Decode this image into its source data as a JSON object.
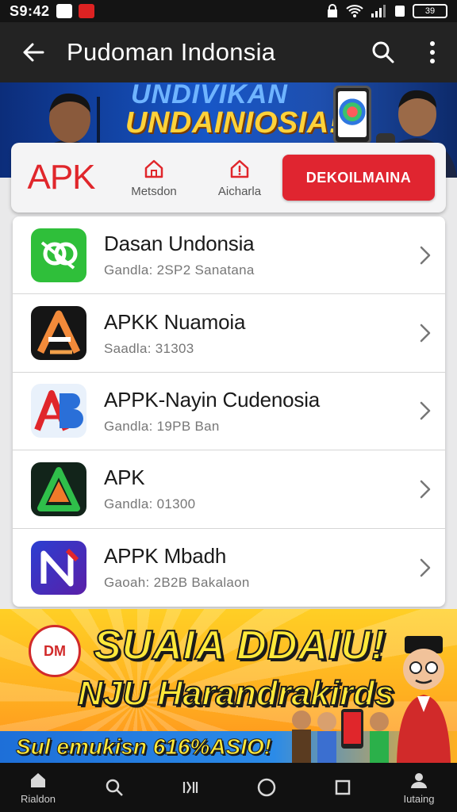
{
  "status_bar": {
    "time": "S9:42",
    "battery": "39"
  },
  "app_bar": {
    "title": "Pudoman Indonsia"
  },
  "top_banner": {
    "line1": "UNDIVIKAN",
    "line2": "UNDAINIOSIA!"
  },
  "tabs": {
    "logo": "APK",
    "items": [
      {
        "label": "Metsdon",
        "icon": "home-icon"
      },
      {
        "label": "Aicharla",
        "icon": "alert-home-icon"
      }
    ],
    "download_label": "DEKOILMAINA"
  },
  "apps": [
    {
      "title": "Dasan Undonsia",
      "subtitle": "Gandla: 2SP2 Sanatana",
      "icon": "green-link-icon"
    },
    {
      "title": "APKK Nuamoia",
      "subtitle": "Saadla: 31303",
      "icon": "orange-a-icon"
    },
    {
      "title": "APPK-Nayin Cudenosia",
      "subtitle": "Gandla: 19PB Ban",
      "icon": "blue-ab-icon"
    },
    {
      "title": "APK",
      "subtitle": "Gandla: 01300",
      "icon": "green-a-icon"
    },
    {
      "title": "APPK Mbadh",
      "subtitle": "Gaoah: 2B2B Bakalaon",
      "icon": "purple-n-icon"
    }
  ],
  "bottom_banner": {
    "logo": "DM",
    "line1": "SUAIA DDAIU!",
    "line2": "NJU Harandrakirds",
    "line3": "Sul emukisn 616%ASIO!"
  },
  "nav": [
    {
      "label": "Rialdon",
      "icon": "home-icon"
    },
    {
      "label": "",
      "icon": "search-icon"
    },
    {
      "label": "",
      "icon": "recent-apps-icon"
    },
    {
      "label": "",
      "icon": "circle-home-icon"
    },
    {
      "label": "",
      "icon": "square-icon"
    },
    {
      "label": "Iutaing",
      "icon": "person-icon"
    }
  ],
  "colors": {
    "accent_red": "#e02530",
    "app_bar": "#232323",
    "banner_blue": "#1756c7",
    "banner_yellow": "#ffcf25"
  }
}
